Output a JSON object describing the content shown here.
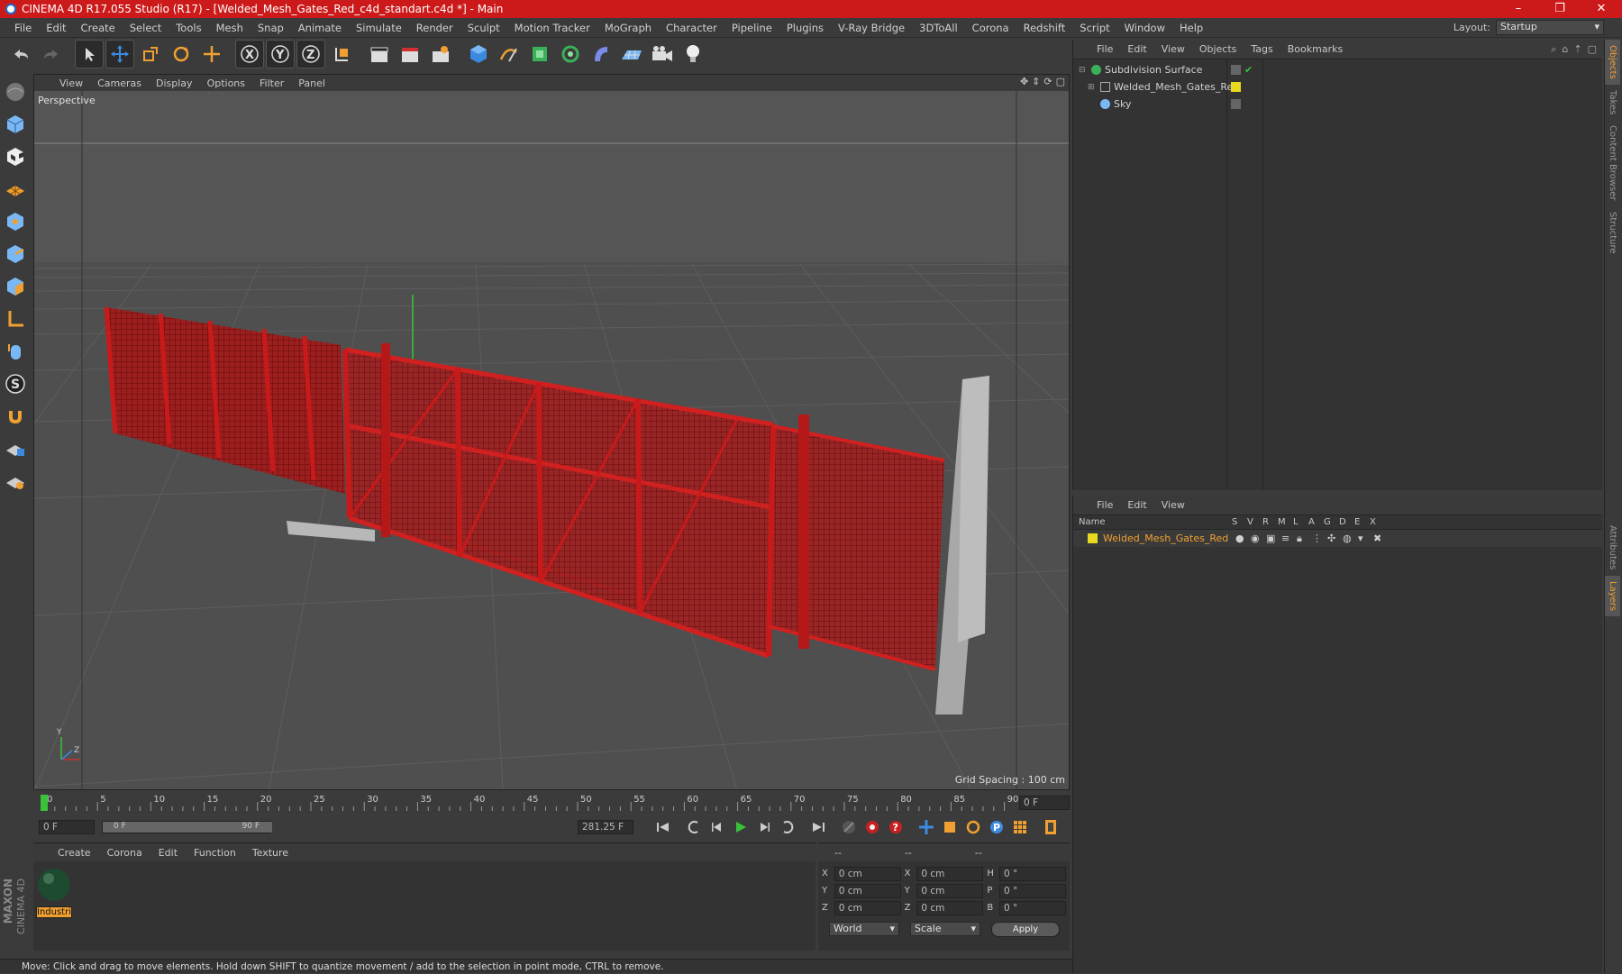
{
  "window": {
    "title": "CINEMA 4D R17.055 Studio (R17) - [Welded_Mesh_Gates_Red_c4d_standart.c4d *] - Main",
    "minimize": "–",
    "restore": "❐",
    "close": "✕"
  },
  "menu": {
    "items": [
      "File",
      "Edit",
      "Create",
      "Select",
      "Tools",
      "Mesh",
      "Snap",
      "Animate",
      "Simulate",
      "Render",
      "Sculpt",
      "Motion Tracker",
      "MoGraph",
      "Character",
      "Pipeline",
      "Plugins",
      "V-Ray Bridge",
      "3DToAll",
      "Corona",
      "Redshift",
      "Script",
      "Window",
      "Help"
    ],
    "layout_label": "Layout:",
    "layout_value": "Startup"
  },
  "viewport": {
    "menu": [
      "View",
      "Cameras",
      "Display",
      "Options",
      "Filter",
      "Panel"
    ],
    "label": "Perspective",
    "grid_spacing": "Grid Spacing : 100 cm"
  },
  "timeline": {
    "ticks": [
      "0",
      "5",
      "10",
      "15",
      "20",
      "25",
      "30",
      "35",
      "40",
      "45",
      "50",
      "55",
      "60",
      "65",
      "70",
      "75",
      "80",
      "85",
      "90"
    ],
    "current_frame": "0 F"
  },
  "transport": {
    "start_field": "0 F",
    "range_start": "0 F",
    "range_end": "90 F",
    "fps_field": "281.25 F"
  },
  "material_panel": {
    "menu": [
      "Create",
      "Corona",
      "Edit",
      "Function",
      "Texture"
    ],
    "material_name": "Industri"
  },
  "coords": {
    "headers": [
      "--",
      "--",
      "--"
    ],
    "rows": [
      {
        "a": "X",
        "av": "0 cm",
        "b": "X",
        "bv": "0 cm",
        "c": "H",
        "cv": "0 °"
      },
      {
        "a": "Y",
        "av": "0 cm",
        "b": "Y",
        "bv": "0 cm",
        "c": "P",
        "cv": "0 °"
      },
      {
        "a": "Z",
        "av": "0 cm",
        "b": "Z",
        "bv": "0 cm",
        "c": "B",
        "cv": "0 °"
      }
    ],
    "mode1": "World",
    "mode2": "Scale",
    "apply": "Apply"
  },
  "objects_panel": {
    "menu": [
      "File",
      "Edit",
      "View",
      "Objects",
      "Tags",
      "Bookmarks"
    ],
    "items": [
      {
        "name": "Subdivision Surface",
        "color": "#999999"
      },
      {
        "name": "Welded_Mesh_Gates_Red",
        "color": "#e8d820"
      },
      {
        "name": "Sky",
        "color": "#999999"
      }
    ]
  },
  "layers_panel": {
    "menu": [
      "File",
      "Edit",
      "View"
    ],
    "columns": [
      "Name",
      "S",
      "V",
      "R",
      "M",
      "L",
      "A",
      "G",
      "D",
      "E",
      "X"
    ],
    "layer_name": "Welded_Mesh_Gates_Red",
    "layer_color": "#e8d820"
  },
  "right_tabs": [
    "Objects",
    "Takes",
    "Content Browser",
    "Structure",
    "Attributes",
    "Layers"
  ],
  "status": "Move: Click and drag to move elements. Hold down SHIFT to quantize movement / add to the selection in point mode, CTRL to remove.",
  "logo": {
    "line1": "MAXON",
    "line2": "CINEMA 4D"
  },
  "colors": {
    "accent": "#f0a030",
    "gate_red": "#b81414",
    "title_red": "#cc1a1a"
  }
}
